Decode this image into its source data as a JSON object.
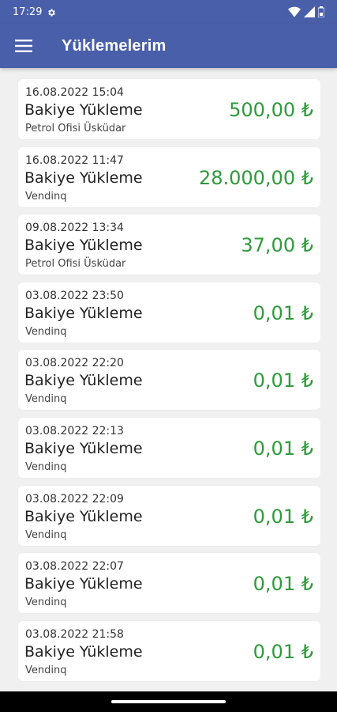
{
  "status_bar": {
    "time": "17:29"
  },
  "header": {
    "title": "Yüklemelerim",
    "color": "#4a5faa"
  },
  "accent_amount_color": "#2e9b3a",
  "items": [
    {
      "date": "16.08.2022 15:04",
      "title": "Bakiye Yükleme",
      "location": "Petrol Ofisi Üsküdar",
      "amount": "500,00 ₺"
    },
    {
      "date": "16.08.2022 11:47",
      "title": "Bakiye Yükleme",
      "location": "Vendinq",
      "amount": "28.000,00 ₺"
    },
    {
      "date": "09.08.2022 13:34",
      "title": "Bakiye Yükleme",
      "location": "Petrol Ofisi Üsküdar",
      "amount": "37,00 ₺"
    },
    {
      "date": "03.08.2022 23:50",
      "title": "Bakiye Yükleme",
      "location": "Vendinq",
      "amount": "0,01 ₺"
    },
    {
      "date": "03.08.2022 22:20",
      "title": "Bakiye Yükleme",
      "location": "Vendinq",
      "amount": "0,01 ₺"
    },
    {
      "date": "03.08.2022 22:13",
      "title": "Bakiye Yükleme",
      "location": "Vendinq",
      "amount": "0,01 ₺"
    },
    {
      "date": "03.08.2022 22:09",
      "title": "Bakiye Yükleme",
      "location": "Vendinq",
      "amount": "0,01 ₺"
    },
    {
      "date": "03.08.2022 22:07",
      "title": "Bakiye Yükleme",
      "location": "Vendinq",
      "amount": "0,01 ₺"
    },
    {
      "date": "03.08.2022 21:58",
      "title": "Bakiye Yükleme",
      "location": "Vendinq",
      "amount": "0,01 ₺"
    }
  ]
}
